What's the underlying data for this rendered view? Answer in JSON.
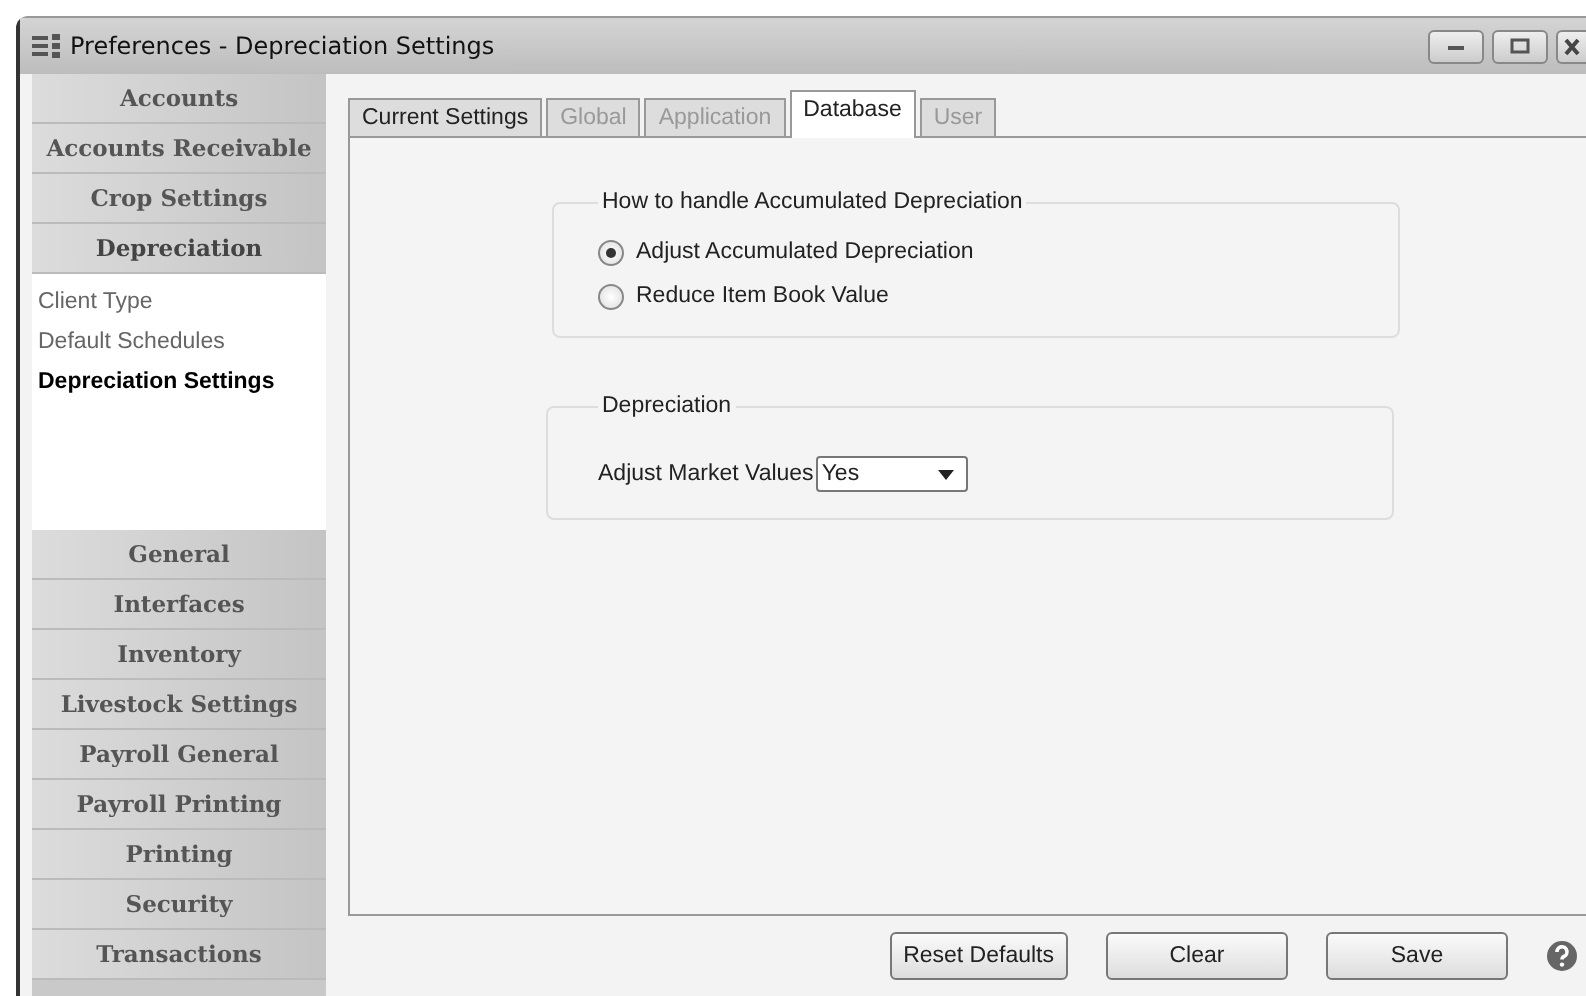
{
  "window": {
    "title": "Preferences - Depreciation Settings"
  },
  "sidebar": {
    "sections": [
      {
        "label": "Accounts",
        "expanded": false
      },
      {
        "label": "Accounts Receivable",
        "expanded": false
      },
      {
        "label": "Crop Settings",
        "expanded": false
      },
      {
        "label": "Depreciation",
        "expanded": true,
        "children": [
          {
            "label": "Client Type",
            "selected": false
          },
          {
            "label": "Default Schedules",
            "selected": false
          },
          {
            "label": "Depreciation Settings",
            "selected": true
          }
        ]
      },
      {
        "label": "General",
        "expanded": false
      },
      {
        "label": "Interfaces",
        "expanded": false
      },
      {
        "label": "Inventory",
        "expanded": false
      },
      {
        "label": "Livestock Settings",
        "expanded": false
      },
      {
        "label": "Payroll General",
        "expanded": false
      },
      {
        "label": "Payroll Printing",
        "expanded": false
      },
      {
        "label": "Printing",
        "expanded": false
      },
      {
        "label": "Security",
        "expanded": false
      },
      {
        "label": "Transactions",
        "expanded": false
      }
    ]
  },
  "tabs": [
    {
      "label": "Current Settings",
      "selected": false,
      "disabled": false
    },
    {
      "label": "Global",
      "selected": false,
      "disabled": true
    },
    {
      "label": "Application",
      "selected": false,
      "disabled": true
    },
    {
      "label": "Database",
      "selected": true,
      "disabled": false
    },
    {
      "label": "User",
      "selected": false,
      "disabled": true
    }
  ],
  "accumulated_group": {
    "title": "How to handle Accumulated Depreciation",
    "options": [
      {
        "label": "Adjust Accumulated Depreciation",
        "selected": true
      },
      {
        "label": "Reduce Item Book Value",
        "selected": false
      }
    ]
  },
  "depreciation_group": {
    "title": "Depreciation",
    "label": "Adjust Market Values",
    "value": "Yes"
  },
  "buttons": [
    "Reset Defaults",
    "Clear",
    "Save"
  ]
}
